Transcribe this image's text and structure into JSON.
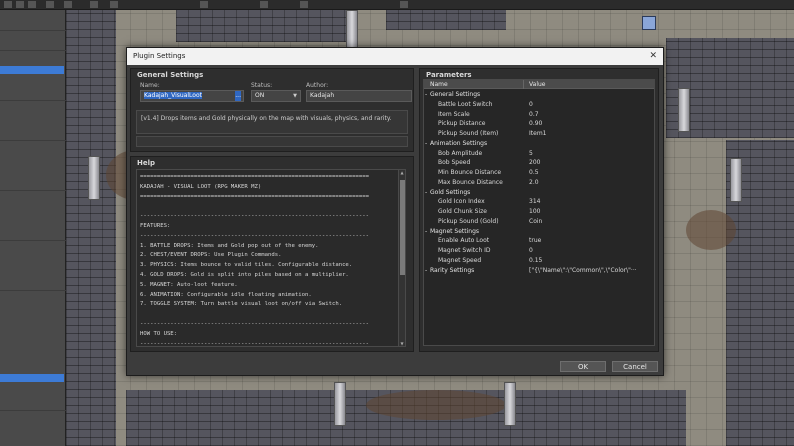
{
  "dialog": {
    "title": "Plugin Settings",
    "close_glyph": "✕",
    "ok_label": "OK",
    "cancel_label": "Cancel"
  },
  "general": {
    "heading": "General Settings",
    "name_label": "Name:",
    "name_value": "Kadajah_VisualLoot",
    "name_button": "...",
    "status_label": "Status:",
    "status_value": "ON",
    "author_label": "Author:",
    "author_value": "Kadajah",
    "description": "[v1.4] Drops items and Gold physically on the map with visuals, physics, and rarity."
  },
  "help": {
    "heading": "Help",
    "lines": [
      "====================================================================",
      "KADAJAH - VISUAL LOOT (RPG MAKER MZ)",
      "====================================================================",
      "",
      "--------------------------------------------------------------------",
      "FEATURES:",
      "--------------------------------------------------------------------",
      "1. BATTLE DROPS: Items and Gold pop out of the enemy.",
      "2. CHEST/EVENT DROPS: Use Plugin Commands.",
      "3. PHYSICS: Items bounce to valid tiles. Configurable distance.",
      "4. GOLD DROPS: Gold is split into piles based on a multiplier.",
      "5. MAGNET: Auto-loot feature.",
      "6. ANIMATION: Configurable idle floating animation.",
      "7. TOGGLE SYSTEM: Turn battle visual loot on/off via Switch.",
      "",
      "--------------------------------------------------------------------",
      "HOW TO USE:",
      "--------------------------------------------------------------------"
    ]
  },
  "params": {
    "heading": "Parameters",
    "col_name": "Name",
    "col_value": "Value",
    "rows": [
      {
        "k": "General Settings",
        "v": "",
        "cat": true
      },
      {
        "k": "Battle Loot Switch",
        "v": "0",
        "cat": false
      },
      {
        "k": "Item Scale",
        "v": "0.7",
        "cat": false
      },
      {
        "k": "Pickup Distance",
        "v": "0.90",
        "cat": false
      },
      {
        "k": "Pickup Sound (Item)",
        "v": "Item1",
        "cat": false
      },
      {
        "k": "Animation Settings",
        "v": "",
        "cat": true
      },
      {
        "k": "Bob Amplitude",
        "v": "5",
        "cat": false
      },
      {
        "k": "Bob Speed",
        "v": "200",
        "cat": false
      },
      {
        "k": "Min Bounce Distance",
        "v": "0.5",
        "cat": false
      },
      {
        "k": "Max Bounce Distance",
        "v": "2.0",
        "cat": false
      },
      {
        "k": "Gold Settings",
        "v": "",
        "cat": true
      },
      {
        "k": "Gold Icon Index",
        "v": "314",
        "cat": false
      },
      {
        "k": "Gold Chunk Size",
        "v": "100",
        "cat": false
      },
      {
        "k": "Pickup Sound (Gold)",
        "v": "Coin",
        "cat": false
      },
      {
        "k": "Magnet Settings",
        "v": "",
        "cat": true
      },
      {
        "k": "Enable Auto Loot",
        "v": "true",
        "cat": false
      },
      {
        "k": "Magnet Switch ID",
        "v": "0",
        "cat": false
      },
      {
        "k": "Magnet Speed",
        "v": "0.15",
        "cat": false
      },
      {
        "k": "Rarity Settings",
        "v": "[\"{\\\"Name\\\":\\\"Common\\\",\\\"Color\\\"···",
        "cat": true
      }
    ]
  },
  "colors": {
    "selection": "#2f67c2",
    "panel": "#2e2e2e",
    "dialog": "#3c3c3c"
  }
}
